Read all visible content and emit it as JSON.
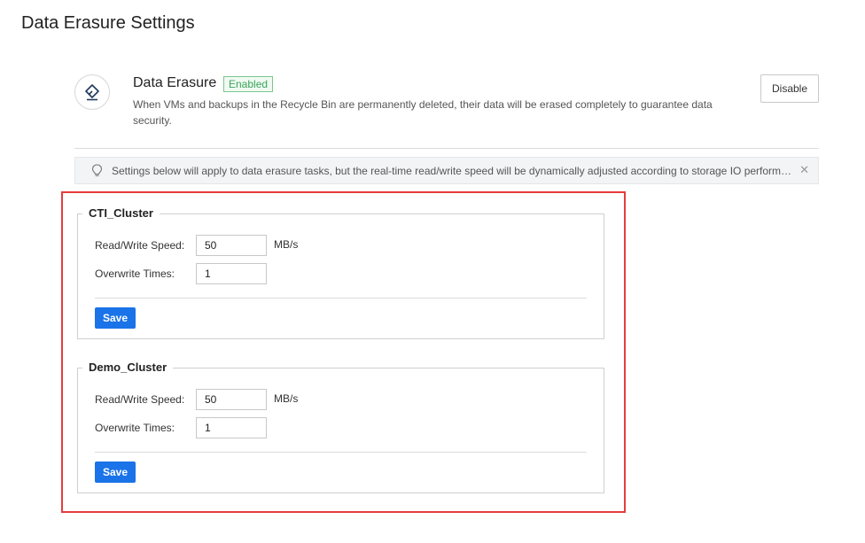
{
  "page": {
    "title": "Data Erasure Settings"
  },
  "feature": {
    "icon": "eraser-icon",
    "name": "Data Erasure",
    "status": "Enabled",
    "status_color": "#3aa55a",
    "description": "When VMs and backups in the Recycle Bin are permanently deleted, their data will be erased completely to guarantee data security.",
    "action_label": "Disable"
  },
  "notice": {
    "icon": "lightbulb-icon",
    "text": "Settings below will apply to data erasure tasks, but the real-time read/write speed will be dynamically adjusted according to storage IO performance.",
    "close_icon": "close-icon"
  },
  "highlight_color": "#e63c3c",
  "accent_color": "#1a73e8",
  "clusters": [
    {
      "name": "CTI_Cluster",
      "speed_label": "Read/Write Speed:",
      "speed_value": "50",
      "speed_unit": "MB/s",
      "overwrite_label": "Overwrite Times:",
      "overwrite_value": "1",
      "save_label": "Save"
    },
    {
      "name": "Demo_Cluster",
      "speed_label": "Read/Write Speed:",
      "speed_value": "50",
      "speed_unit": "MB/s",
      "overwrite_label": "Overwrite Times:",
      "overwrite_value": "1",
      "save_label": "Save"
    }
  ]
}
